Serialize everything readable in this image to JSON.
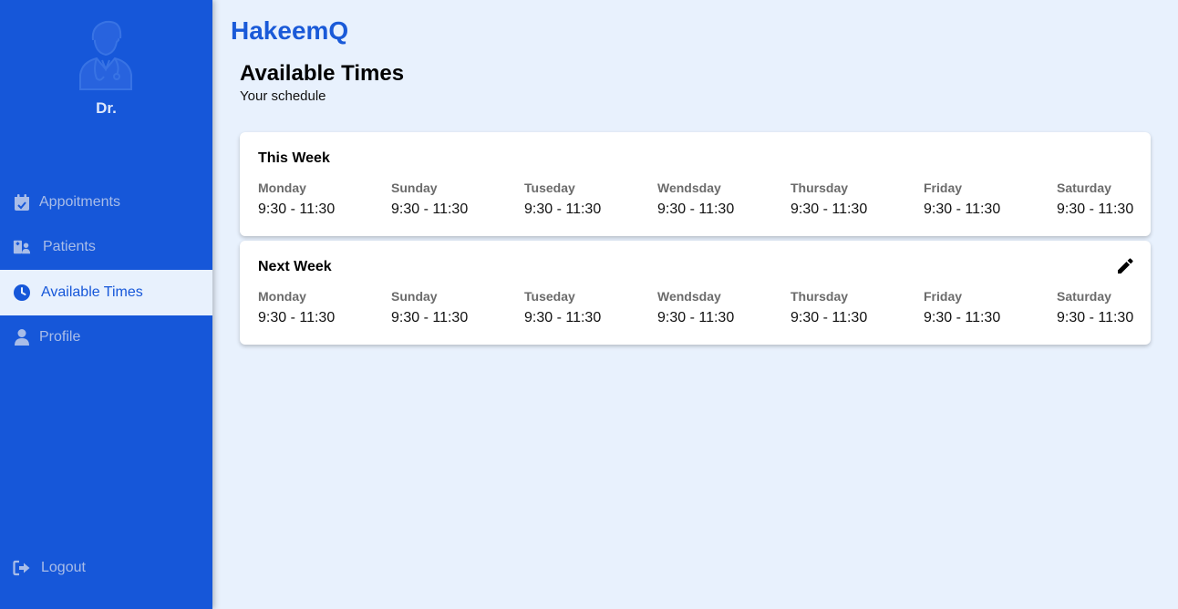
{
  "app": {
    "brand": "HakeemQ"
  },
  "colors": {
    "sidebar": "#1657d9",
    "background": "#e8f1fd",
    "brand": "#1a5ad8"
  },
  "sidebar": {
    "doctor_name": "Dr.",
    "avatar_icon": "doctor-avatar-icon",
    "items": [
      {
        "label": "Appoitments",
        "icon": "calendar-check-icon",
        "active": false
      },
      {
        "label": "Patients",
        "icon": "patients-icon",
        "active": false
      },
      {
        "label": "Available Times",
        "icon": "clock-icon",
        "active": true
      },
      {
        "label": "Profile",
        "icon": "user-icon",
        "active": false
      }
    ],
    "logout_label": "Logout",
    "logout_icon": "sign-out-icon"
  },
  "page": {
    "title": "Available Times",
    "subtitle": "Your schedule"
  },
  "schedules": [
    {
      "title": "This Week",
      "editable": false,
      "days": [
        {
          "name": "Monday",
          "time": "9:30 - 11:30"
        },
        {
          "name": "Sunday",
          "time": "9:30 - 11:30"
        },
        {
          "name": "Tuseday",
          "time": "9:30 - 11:30"
        },
        {
          "name": "Wendsday",
          "time": "9:30 - 11:30"
        },
        {
          "name": "Thursday",
          "time": "9:30 - 11:30"
        },
        {
          "name": "Friday",
          "time": "9:30 - 11:30"
        },
        {
          "name": "Saturday",
          "time": "9:30 - 11:30"
        }
      ]
    },
    {
      "title": "Next Week",
      "editable": true,
      "edit_icon": "pencil-icon",
      "days": [
        {
          "name": "Monday",
          "time": "9:30 - 11:30"
        },
        {
          "name": "Sunday",
          "time": "9:30 - 11:30"
        },
        {
          "name": "Tuseday",
          "time": "9:30 - 11:30"
        },
        {
          "name": "Wendsday",
          "time": "9:30 - 11:30"
        },
        {
          "name": "Thursday",
          "time": "9:30 - 11:30"
        },
        {
          "name": "Friday",
          "time": "9:30 - 11:30"
        },
        {
          "name": "Saturday",
          "time": "9:30 - 11:30"
        }
      ]
    }
  ]
}
